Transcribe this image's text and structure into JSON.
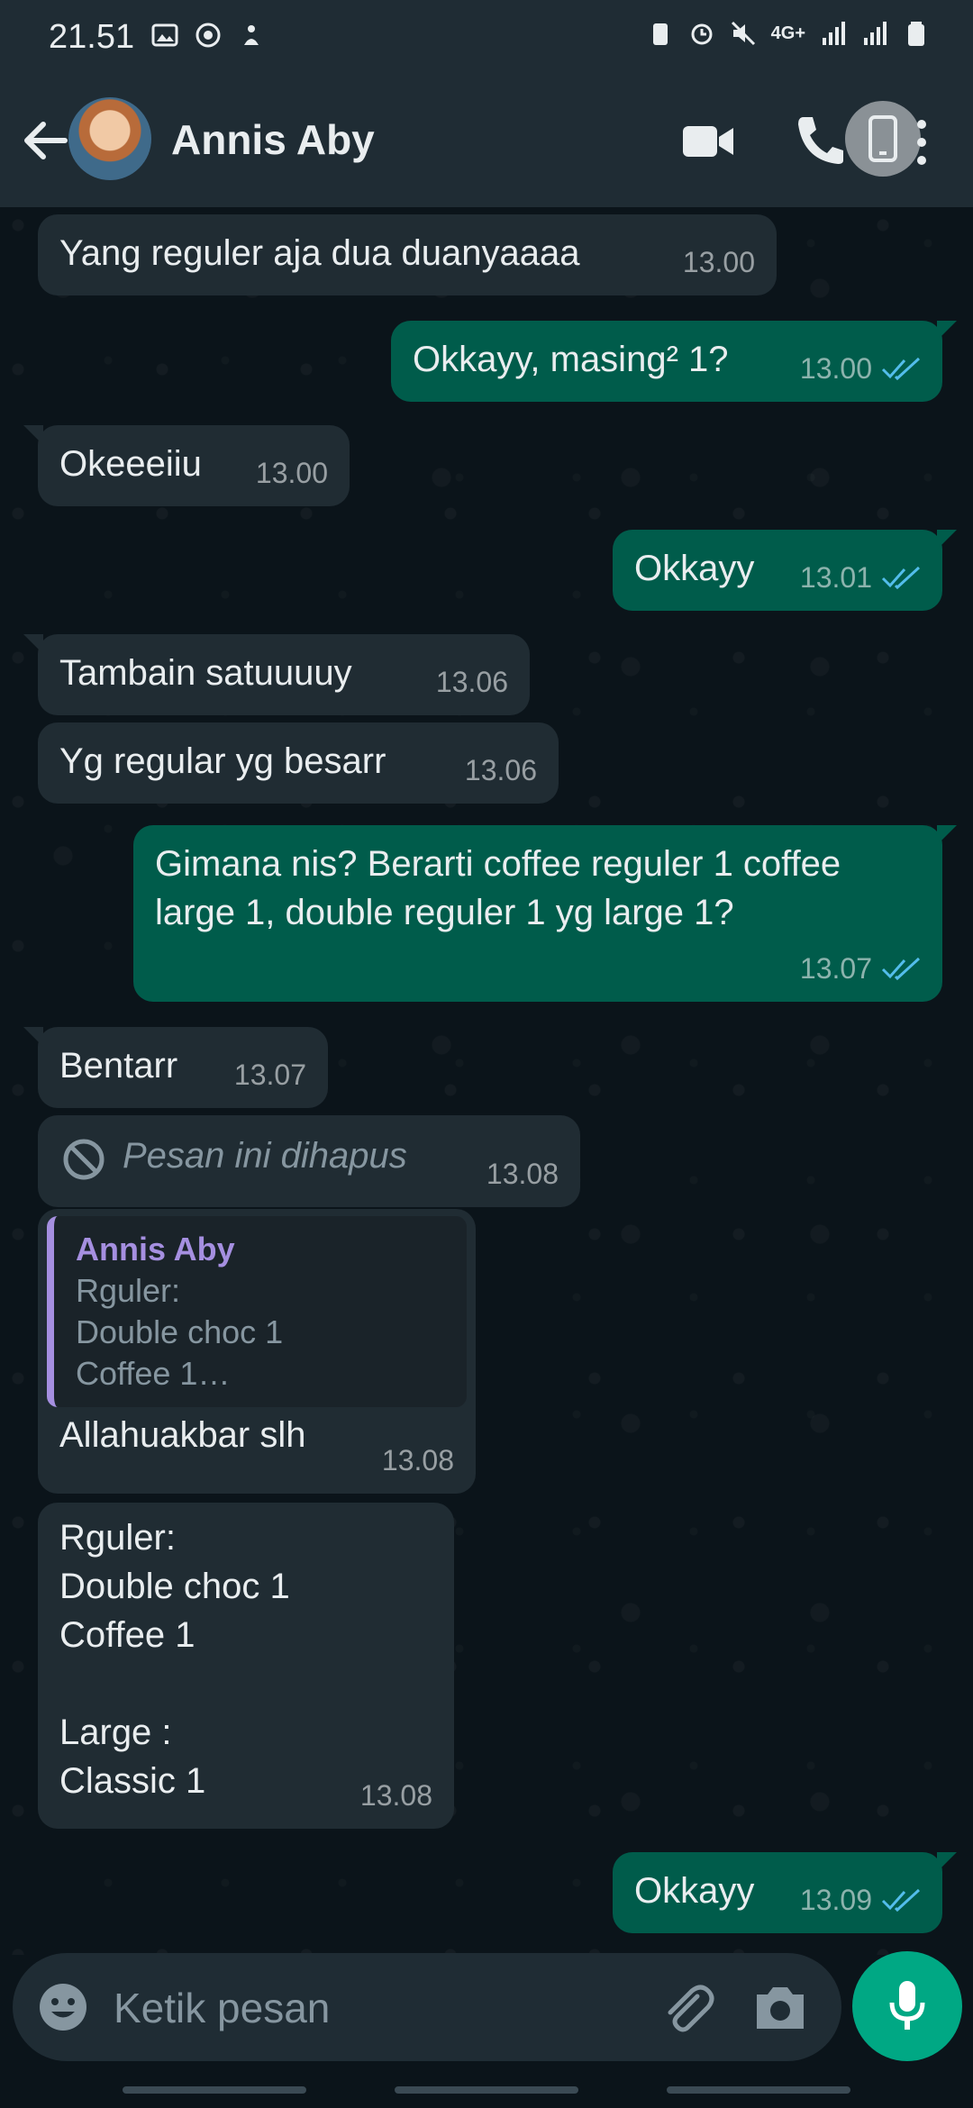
{
  "status_bar": {
    "time": "21.51",
    "network": "4G+"
  },
  "header": {
    "contact_name": "Annis Aby"
  },
  "messages": [
    {
      "dir": "in",
      "text": "Yang reguler aja dua duanyaaaa",
      "time": "13.00"
    },
    {
      "dir": "out",
      "text": "Okkayy, masing² 1?",
      "time": "13.00",
      "read": true
    },
    {
      "dir": "in",
      "text": "Okeeeiiu",
      "time": "13.00"
    },
    {
      "dir": "out",
      "text": "Okkayy",
      "time": "13.01",
      "read": true
    },
    {
      "dir": "in",
      "text": "Tambain satuuuuy",
      "time": "13.06"
    },
    {
      "dir": "in",
      "text": "Yg regular yg besarr",
      "time": "13.06"
    },
    {
      "dir": "out",
      "text": "Gimana nis? Berarti coffee reguler 1 coffee large 1, double reguler 1 yg large 1?",
      "time": "13.07",
      "read": true
    },
    {
      "dir": "in",
      "text": "Bentarr",
      "time": "13.07"
    },
    {
      "dir": "in",
      "deleted": true,
      "text": "Pesan ini dihapus",
      "time": "13.08"
    },
    {
      "dir": "in",
      "quote_name": "Annis Aby",
      "quote_text": "Rguler:\nDouble choc 1\nCoffee 1…",
      "text": "Allahuakbar slh",
      "time": "13.08"
    },
    {
      "dir": "in",
      "text": "Rguler:\nDouble choc 1\nCoffee 1\n\nLarge :\nClassic 1",
      "time": "13.08"
    },
    {
      "dir": "out",
      "text": "Okkayy",
      "time": "13.09",
      "read": true
    }
  ],
  "composer": {
    "placeholder": "Ketik pesan"
  },
  "colors": {
    "incoming_bubble": "#202c33",
    "outgoing_bubble": "#005c4b",
    "accent": "#00a884",
    "read_tick": "#53bdeb",
    "quote_accent": "#a58fe0"
  }
}
